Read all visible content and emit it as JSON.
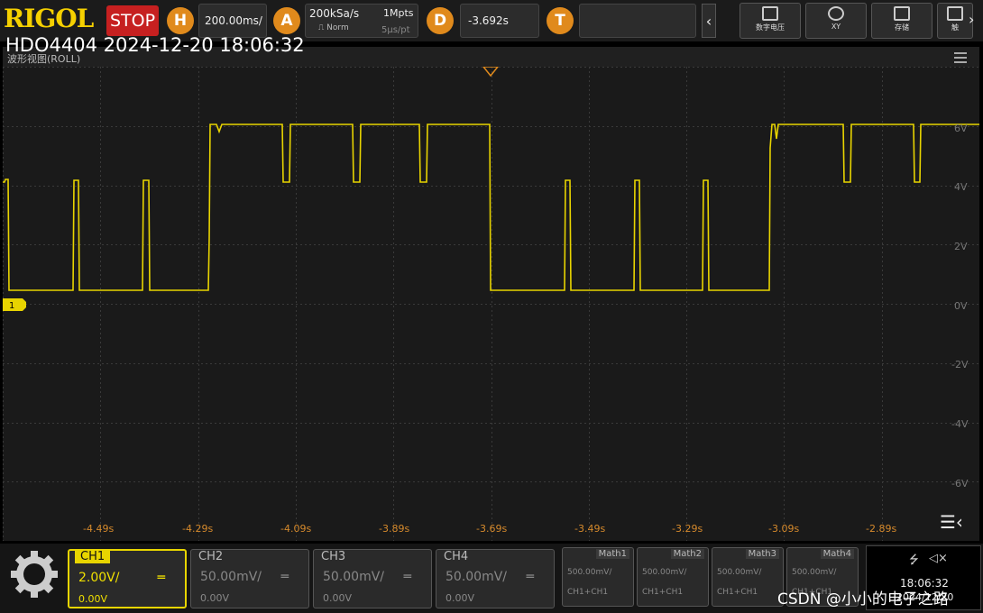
{
  "top_bar": {
    "logo": "RIGOL",
    "run_state": "STOP",
    "horizontal": {
      "badge": "H",
      "timebase": "200.00ms/"
    },
    "acquire": {
      "badge": "A",
      "sample_rate": "200kSa/s",
      "memory_depth": "1Mpts",
      "mode": "Norm",
      "time_per_point": "5μs/pt"
    },
    "delay": {
      "badge": "D",
      "value": "-3.692s"
    },
    "trigger": {
      "badge": "T"
    },
    "quick_buttons": [
      {
        "label": "数字电压"
      },
      {
        "label": "XY"
      },
      {
        "label": "存储"
      },
      {
        "label": "触"
      }
    ]
  },
  "overlay_title": "HDO4404 2024-12-20 18:06:32",
  "waveform": {
    "mode_label": "波形视图(ROLL)",
    "y_labels": [
      "6V",
      "4V",
      "2V",
      "0V",
      "-2V",
      "-4V",
      "-6V"
    ],
    "x_labels": [
      "-4.49s",
      "-4.29s",
      "-4.09s",
      "-3.89s",
      "-3.69s",
      "-3.49s",
      "-3.29s",
      "-3.09s",
      "-2.89s"
    ],
    "ch1_marker": "1",
    "trace_color": "#e8d400",
    "grid_color": "#3a3a3a"
  },
  "channels": [
    {
      "name": "CH1",
      "scale": "2.00V/",
      "offset": "0.00V"
    },
    {
      "name": "CH2",
      "scale": "50.00mV/",
      "offset": "0.00V"
    },
    {
      "name": "CH3",
      "scale": "50.00mV/",
      "offset": "0.00V"
    },
    {
      "name": "CH4",
      "scale": "50.00mV/",
      "offset": "0.00V"
    }
  ],
  "math": [
    {
      "name": "Math1",
      "scale": "500.00mV/",
      "source": "CH1+CH1"
    },
    {
      "name": "Math2",
      "scale": "500.00mV/",
      "source": "CH1+CH1"
    },
    {
      "name": "Math3",
      "scale": "500.00mV/",
      "source": "CH1+CH1"
    },
    {
      "name": "Math4",
      "scale": "500.00mV/",
      "source": "CH1+CH1"
    }
  ],
  "status": {
    "time": "18:06:32",
    "date": "2024/12/20"
  },
  "watermark": "CSDN @小小的电子之路"
}
